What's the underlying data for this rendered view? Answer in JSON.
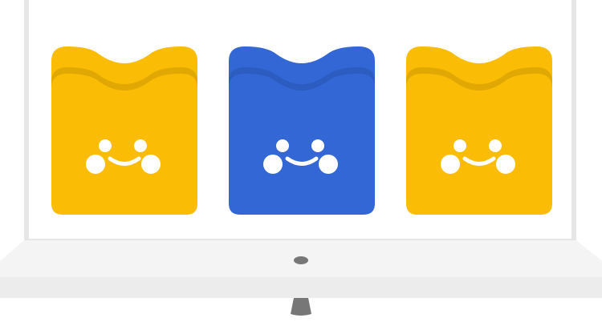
{
  "cabinet": {
    "frame_color": "#e6e6e6",
    "shelf_top_color": "#f4f4f4",
    "shelf_front_color": "#ececec",
    "handle_color": "#777777"
  },
  "shelf_items": [
    {
      "item": "folded-shirt-stack",
      "face": "smiley",
      "color": "#fbbc05",
      "shade": "#f2b200"
    },
    {
      "item": "folded-shirt-stack",
      "face": "smiley",
      "color": "#3367d6",
      "shade": "#2d5dc8"
    },
    {
      "item": "folded-shirt-stack",
      "face": "smiley",
      "color": "#fbbc05",
      "shade": "#f2b200"
    }
  ],
  "face_color": "#ffffff"
}
